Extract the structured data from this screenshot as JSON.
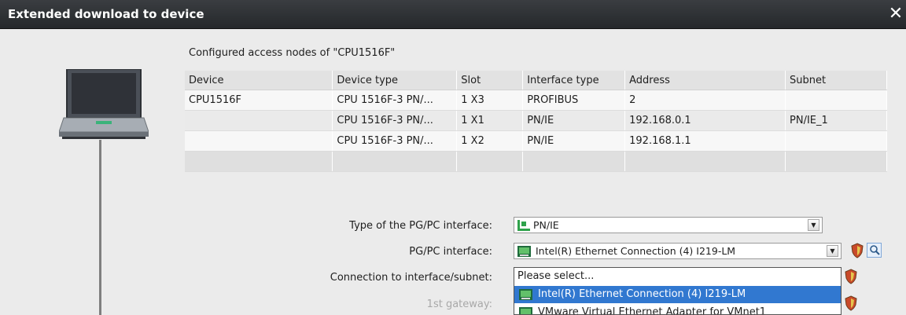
{
  "window": {
    "title": "Extended download to device",
    "close_glyph": "✕"
  },
  "nodes": {
    "title": "Configured access nodes of \"CPU1516F\"",
    "columns": [
      "Device",
      "Device type",
      "Slot",
      "Interface type",
      "Address",
      "Subnet"
    ],
    "rows": [
      [
        "CPU1516F",
        "CPU 1516F-3 PN/...",
        "1 X3",
        "PROFIBUS",
        "2",
        ""
      ],
      [
        "",
        "CPU 1516F-3 PN/...",
        "1 X1",
        "PN/IE",
        "192.168.0.1",
        "PN/IE_1"
      ],
      [
        "",
        "CPU 1516F-3 PN/...",
        "1 X2",
        "PN/IE",
        "192.168.1.1",
        ""
      ],
      [
        "",
        "",
        "",
        "",
        "",
        ""
      ]
    ]
  },
  "form": {
    "type_label": "Type of the PG/PC interface:",
    "type_value": "PN/IE",
    "pgpc_label": "PG/PC interface:",
    "pgpc_value": "Intel(R) Ethernet Connection (4) I219-LM",
    "conn_label": "Connection to interface/subnet:",
    "gateway_label": "1st gateway:"
  },
  "dropdown": {
    "items": [
      "Please select...",
      "Intel(R) Ethernet Connection (4) I219-LM",
      "VMware Virtual Ethernet Adapter for VMnet1"
    ],
    "selected_index": 1
  },
  "icons": {
    "type_icon": "pn-ie-network-icon",
    "nic_icon": "network-card-icon",
    "shield_icon": "shield-icon",
    "search_icon": "search-device-icon"
  },
  "colors": {
    "title_bar": "#2b2e31",
    "selection": "#3178d0"
  }
}
